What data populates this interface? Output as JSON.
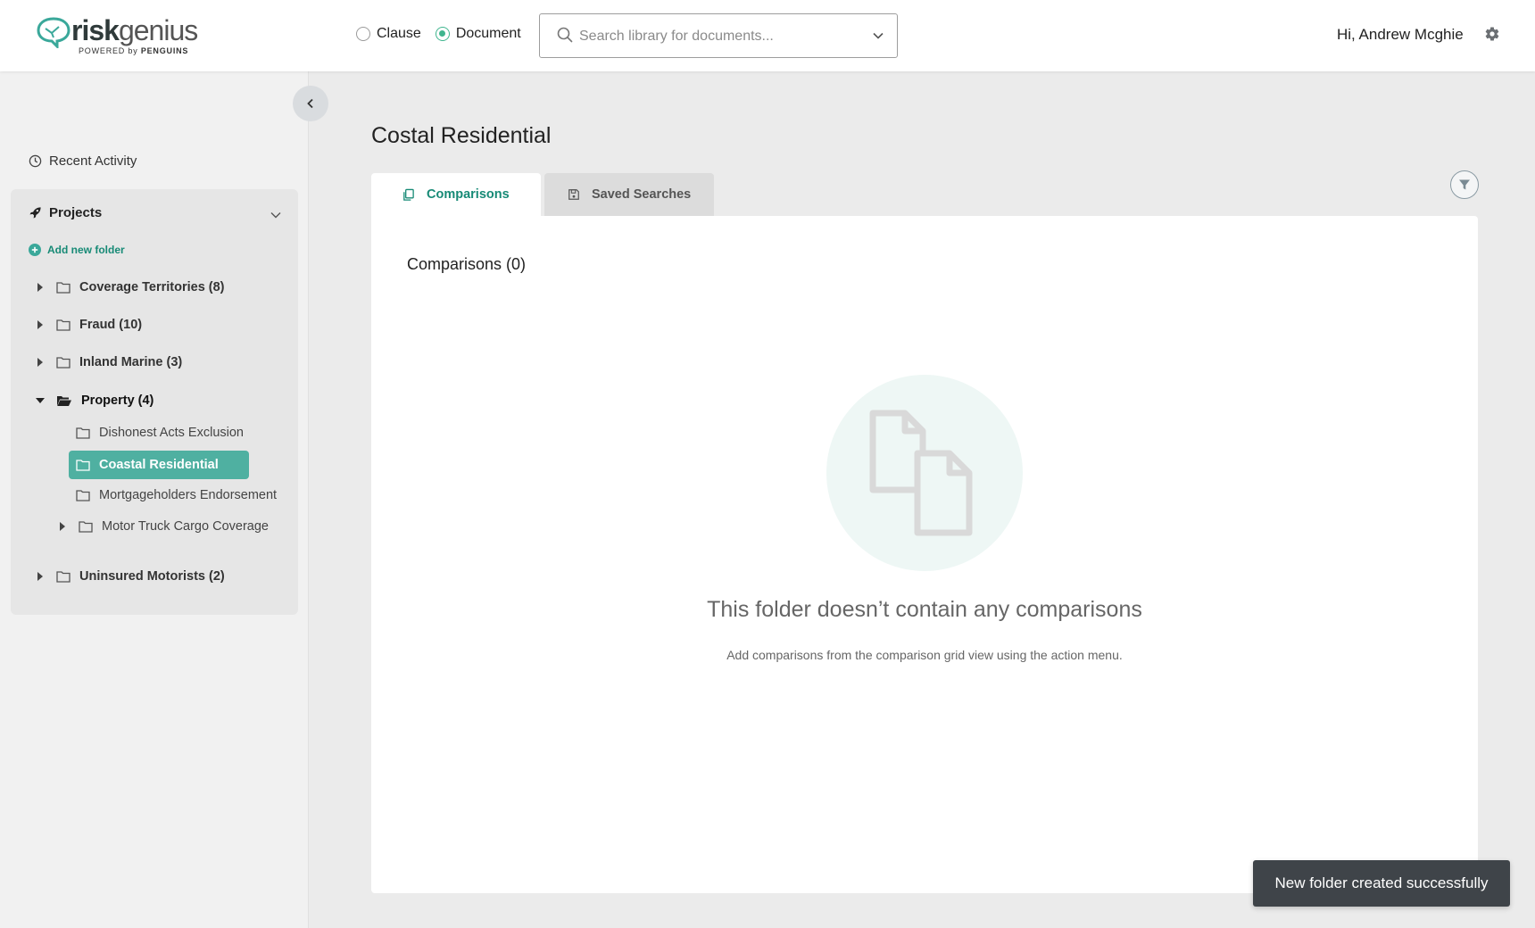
{
  "app": {
    "logo_main_a": "risk",
    "logo_main_b": "genius",
    "logo_sub_a": "POWERED by ",
    "logo_sub_b": "PENGUINS"
  },
  "search_mode": {
    "options": [
      {
        "label": "Clause",
        "selected": false
      },
      {
        "label": "Document",
        "selected": true
      }
    ]
  },
  "search": {
    "placeholder": "Search library for documents...",
    "value": ""
  },
  "user": {
    "greeting": "Hi, Andrew Mcghie"
  },
  "sidebar": {
    "recent_label": "Recent Activity",
    "projects_label": "Projects",
    "add_folder_label": "Add new folder",
    "folders": [
      {
        "label": "Coverage Territories (8)"
      },
      {
        "label": "Fraud (10)"
      },
      {
        "label": "Inland Marine (3)"
      },
      {
        "label": "Property (4)",
        "children": [
          {
            "label": "Dishonest Acts Exclusion"
          },
          {
            "label": "Coastal Residential",
            "active": true
          },
          {
            "label": "Mortgageholders Endorsement"
          },
          {
            "label": "Motor Truck Cargo Coverage"
          }
        ]
      },
      {
        "label": "Uninsured Motorists (2)"
      }
    ]
  },
  "main": {
    "title": "Costal Residential",
    "tabs": [
      {
        "label": "Comparisons",
        "active": true
      },
      {
        "label": "Saved Searches",
        "active": false
      }
    ],
    "section_title": "Comparisons (0)",
    "empty_title": "This folder doesn’t contain any comparisons",
    "empty_subtitle": "Add comparisons from the comparison grid view using the action menu."
  },
  "toast": {
    "message": "New folder created successfully"
  },
  "colors": {
    "accent": "#178a76",
    "active_folder_bg": "#4fb0a1",
    "radio_checked": "#3fb58e",
    "toast_bg": "#3f4449"
  }
}
